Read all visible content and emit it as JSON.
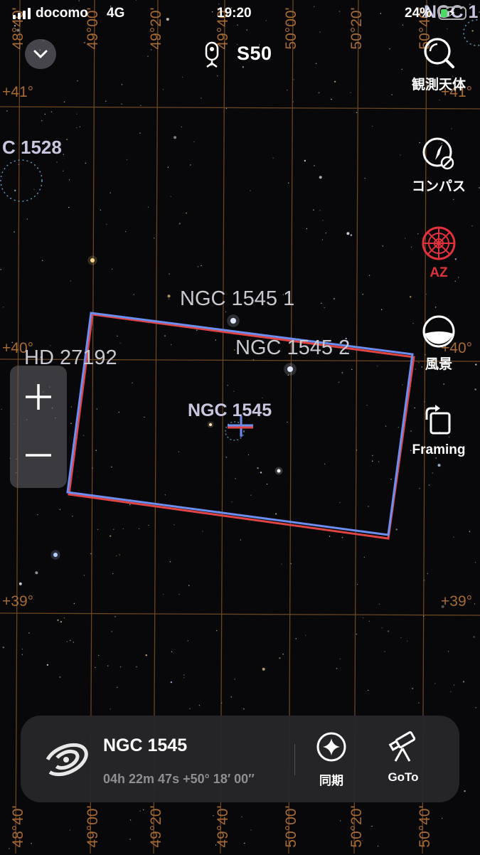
{
  "status_bar": {
    "carrier": "docomo",
    "network": "4G",
    "time": "19:20",
    "battery": "24%"
  },
  "header": {
    "title": "S50"
  },
  "toolbar": {
    "observe_label": "観測天体",
    "compass_label": "コンパス",
    "mount_label": "AZ",
    "landscape_label": "風景",
    "framing_label": "Framing"
  },
  "zoom": {
    "plus": "+",
    "minus": "−"
  },
  "grid_labels": {
    "ra_top": [
      "48°40'",
      "49°00'",
      "49°20'",
      "49°40'",
      "50°00'",
      "50°20'",
      "50°40'"
    ],
    "ra_bottom": [
      "48°40'",
      "49°00'",
      "49°20'",
      "49°40'",
      "50°00'",
      "50°20'",
      "50°40'"
    ],
    "dec_left": [
      "+41°",
      "+40°",
      "+39°"
    ],
    "dec_right": [
      "+41°",
      "+40°",
      "+39°"
    ]
  },
  "sky_objects": {
    "ngc1528": "C 1528",
    "ngc1545_1": "NGC 1545 1",
    "ngc1545_2": "NGC 1545 2",
    "hd27192": "HD 27192",
    "ngc1545": "NGC 1545",
    "ngc_corner": "NGC 1"
  },
  "target_card": {
    "name": "NGC 1545",
    "coords": "04h 22m 47s  +50° 18′ 00″",
    "sync_label": "同期",
    "goto_label": "GoTo"
  },
  "colors": {
    "grid": "#6b4420",
    "grid_label": "#a66a35",
    "frame_blue": "#6b8ef0",
    "frame_red": "#e04545",
    "accent_red": "#e0323c",
    "card_bg": "#26262a"
  }
}
